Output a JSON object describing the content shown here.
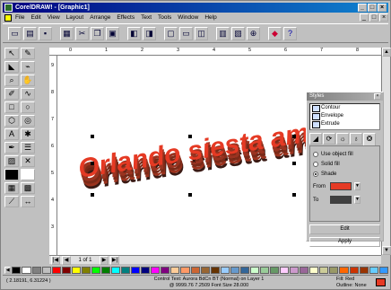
{
  "window": {
    "title": "CorelDRAW! - [Graphic1]",
    "controls": [
      "_",
      "□",
      "×"
    ]
  },
  "menubar": {
    "items": [
      "File",
      "Edit",
      "View",
      "Layout",
      "Arrange",
      "Effects",
      "Text",
      "Tools",
      "Window",
      "Help"
    ],
    "mdi_controls": [
      "_",
      "□",
      "×"
    ]
  },
  "toolbar": {
    "buttons": [
      "new-icon",
      "open-icon",
      "save-icon",
      "print-icon",
      "cut-icon",
      "copy-icon",
      "paste-icon",
      "import-icon",
      "export-icon",
      "wireframe-icon",
      "zoom-icon",
      "app-launcher-icon",
      "help-icon"
    ]
  },
  "rulers": {
    "h_ticks": [
      "0",
      "1",
      "2",
      "3",
      "4",
      "5",
      "6",
      "7",
      "8"
    ],
    "v_ticks": [
      "9",
      "8",
      "7",
      "6",
      "5",
      "4",
      "3"
    ]
  },
  "canvas": {
    "art_text": "Orlando siesta am 97"
  },
  "hscroll": {
    "page_label": "1 of 1"
  },
  "docker": {
    "title": "Styles",
    "effects": [
      "Contour",
      "Envelope",
      "Extrude"
    ],
    "fill_options": {
      "use_object_fill": "Use object fill",
      "solid_fill": "Solid fill",
      "shade": "Shade",
      "selected": "shade"
    },
    "from_label": "From",
    "to_label": "To",
    "from_color": "#e53a24",
    "to_color": "#404040",
    "edit_label": "Edit",
    "apply_label": "Apply"
  },
  "palette": [
    "#000000",
    "#ffffff",
    "#808080",
    "#c0c0c0",
    "#ff0000",
    "#800000",
    "#ffff00",
    "#808000",
    "#00ff00",
    "#008000",
    "#00ffff",
    "#008080",
    "#0000ff",
    "#000080",
    "#ff00ff",
    "#800080",
    "#ffcc99",
    "#ff9966",
    "#cc6633",
    "#996633",
    "#663300",
    "#99ccff",
    "#6699cc",
    "#336699",
    "#ccffcc",
    "#99cc99",
    "#669966",
    "#ffccff",
    "#cc99cc",
    "#996699",
    "#ffffcc",
    "#cccc99",
    "#999966",
    "#ff6600",
    "#cc3300",
    "#993300",
    "#66ccff",
    "#3399ff"
  ],
  "statusbar": {
    "coords": "( 2.18191, 6.31224 )",
    "object_info": "Control Text: Aurora BdCn BT (Normal) on Layer 1",
    "object_info2": "@ 9999.76 7.2509  Font Size 28.000",
    "fill_label": "Fill: Red",
    "outline_label": "Outline: None"
  },
  "colors": {
    "text_fill": "#e53a24",
    "extrude_shade": "#3a1a14"
  }
}
